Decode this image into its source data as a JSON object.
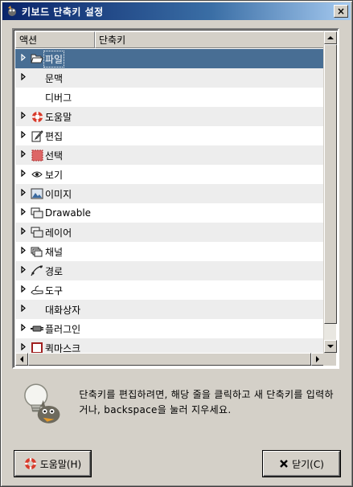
{
  "window": {
    "title": "키보드 단축키 설정",
    "close_glyph": "×"
  },
  "tree": {
    "columns": {
      "action": "액션",
      "shortcut": "단축키"
    },
    "rows": [
      {
        "label": "파일",
        "icon": "folder-open-icon",
        "expandable": true,
        "selected": true
      },
      {
        "label": "문맥",
        "icon": "",
        "expandable": true,
        "selected": false
      },
      {
        "label": "디버그",
        "icon": "",
        "expandable": false,
        "selected": false
      },
      {
        "label": "도움말",
        "icon": "lifebuoy-icon",
        "expandable": true,
        "selected": false
      },
      {
        "label": "편집",
        "icon": "edit-paper-icon",
        "expandable": true,
        "selected": false
      },
      {
        "label": "선택",
        "icon": "selection-icon",
        "expandable": true,
        "selected": false
      },
      {
        "label": "보기",
        "icon": "eye-icon",
        "expandable": true,
        "selected": false
      },
      {
        "label": "이미지",
        "icon": "image-icon",
        "expandable": true,
        "selected": false
      },
      {
        "label": "Drawable",
        "icon": "drawable-icon",
        "expandable": true,
        "selected": false
      },
      {
        "label": "레이어",
        "icon": "layers-icon",
        "expandable": true,
        "selected": false
      },
      {
        "label": "채널",
        "icon": "channels-icon",
        "expandable": true,
        "selected": false
      },
      {
        "label": "경로",
        "icon": "path-icon",
        "expandable": true,
        "selected": false
      },
      {
        "label": "도구",
        "icon": "tool-icon",
        "expandable": true,
        "selected": false
      },
      {
        "label": "대화상자",
        "icon": "",
        "expandable": true,
        "selected": false
      },
      {
        "label": "플러그인",
        "icon": "plugin-icon",
        "expandable": true,
        "selected": false
      },
      {
        "label": "퀵마스크",
        "icon": "quickmask-icon",
        "expandable": true,
        "selected": false
      }
    ]
  },
  "hint": {
    "text": "단축키를 편집하려면, 해당 줄을 클릭하고 새 단축키를 입력하거나, backspace을 눌러 지우세요."
  },
  "buttons": {
    "help_label": "도움말(H)",
    "close_label": "닫기(C)"
  },
  "colors": {
    "selected_row": "#486e94",
    "alt_row": "#ededed",
    "dialog_bg": "#d4d0c8"
  }
}
